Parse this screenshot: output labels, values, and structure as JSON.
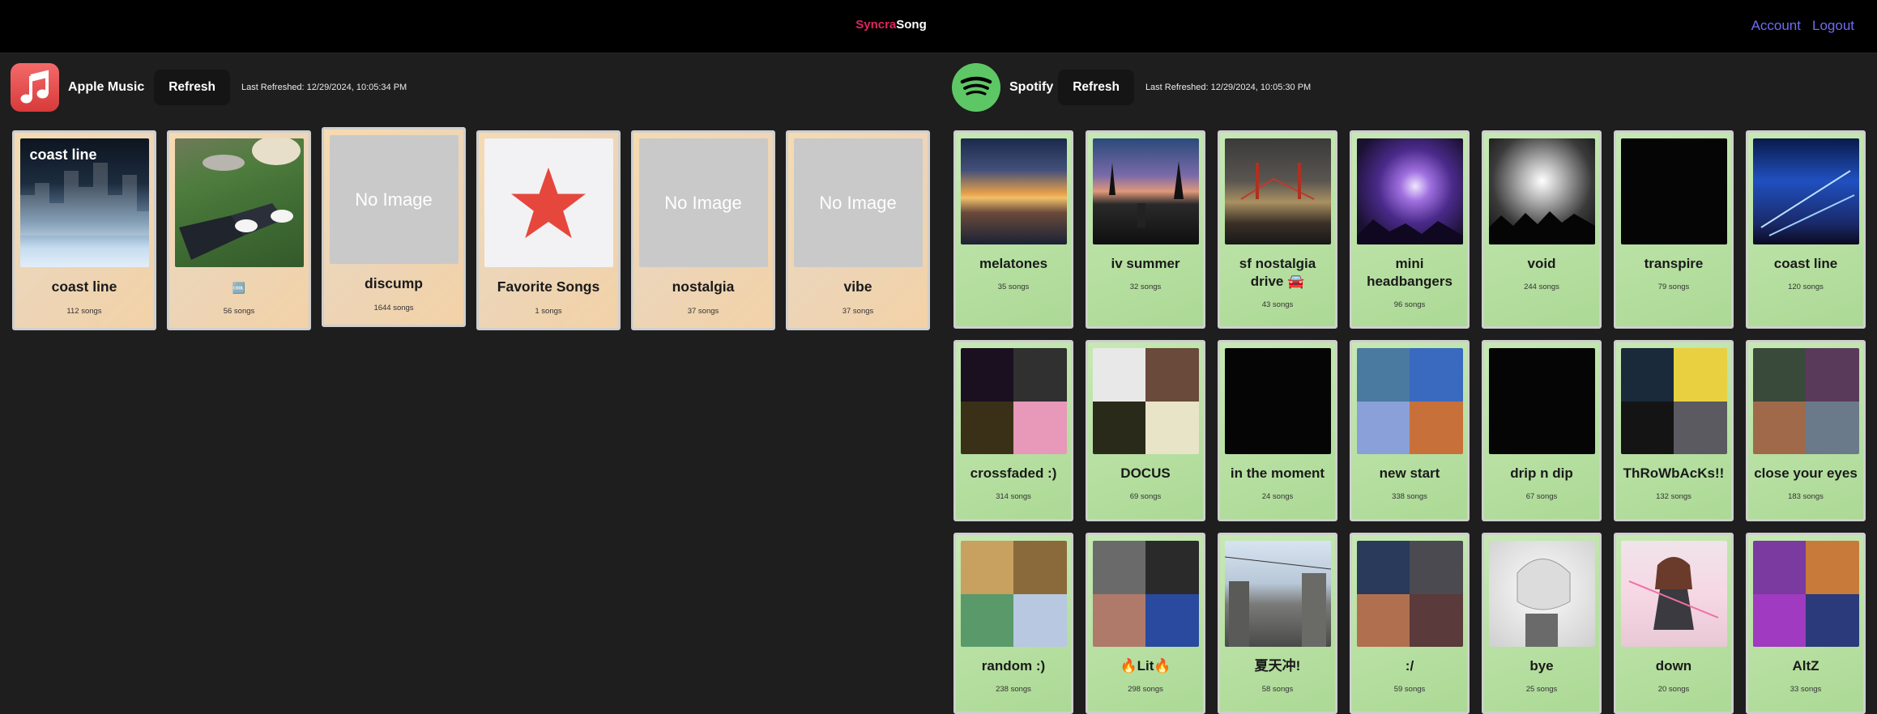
{
  "app": {
    "brand_part1": "Syncra",
    "brand_part2": "Song",
    "nav": {
      "account": "Account",
      "logout": "Logout"
    }
  },
  "apple": {
    "service_name": "Apple Music",
    "refresh_label": "Refresh",
    "last_refreshed": "Last Refreshed: 12/29/2024, 10:05:34 PM",
    "playlists": [
      {
        "title": "coast line",
        "count": "112 songs",
        "art_label": "coast line"
      },
      {
        "title": "🆒",
        "count": "56 songs"
      },
      {
        "title": "discump",
        "count": "1644 songs",
        "no_image": "No Image"
      },
      {
        "title": "Favorite Songs",
        "count": "1 songs"
      },
      {
        "title": "nostalgia",
        "count": "37 songs",
        "no_image": "No Image"
      },
      {
        "title": "vibe",
        "count": "37 songs",
        "no_image": "No Image"
      }
    ]
  },
  "spotify": {
    "service_name": "Spotify",
    "refresh_label": "Refresh",
    "last_refreshed": "Last Refreshed: 12/29/2024, 10:05:30 PM",
    "playlists": [
      {
        "title": "melatones",
        "count": "35 songs"
      },
      {
        "title": "iv summer",
        "count": "32 songs"
      },
      {
        "title": "sf nostalgia drive 🚘",
        "count": "43 songs"
      },
      {
        "title": "mini headbangers",
        "count": "96 songs"
      },
      {
        "title": "void",
        "count": "244 songs"
      },
      {
        "title": "transpire",
        "count": "79 songs"
      },
      {
        "title": "coast line",
        "count": "120 songs"
      },
      {
        "title": "crossfaded :)",
        "count": "314 songs"
      },
      {
        "title": "DOCUS",
        "count": "69 songs"
      },
      {
        "title": "in the moment",
        "count": "24 songs"
      },
      {
        "title": "new start",
        "count": "338 songs"
      },
      {
        "title": "drip n dip",
        "count": "67 songs"
      },
      {
        "title": "ThRoWbAcKs!!",
        "count": "132 songs"
      },
      {
        "title": "close your eyes",
        "count": "183 songs"
      },
      {
        "title": "random :)",
        "count": "238 songs"
      },
      {
        "title": "🔥Lit🔥",
        "count": "298 songs"
      },
      {
        "title": "夏天冲!",
        "count": "58 songs"
      },
      {
        "title": ":/",
        "count": "59 songs"
      },
      {
        "title": "bye",
        "count": "25 songs"
      },
      {
        "title": "down",
        "count": "20 songs"
      },
      {
        "title": "AltZ",
        "count": "33 songs"
      }
    ]
  },
  "icons": {
    "apple_logo": "music-note-icon",
    "spotify_logo": "spotify-icon"
  },
  "colors": {
    "brand_accent": "#e0245e",
    "nav_link": "#6f6cf5",
    "apple_logo": "#e04848",
    "spotify_logo": "#5ec765"
  }
}
